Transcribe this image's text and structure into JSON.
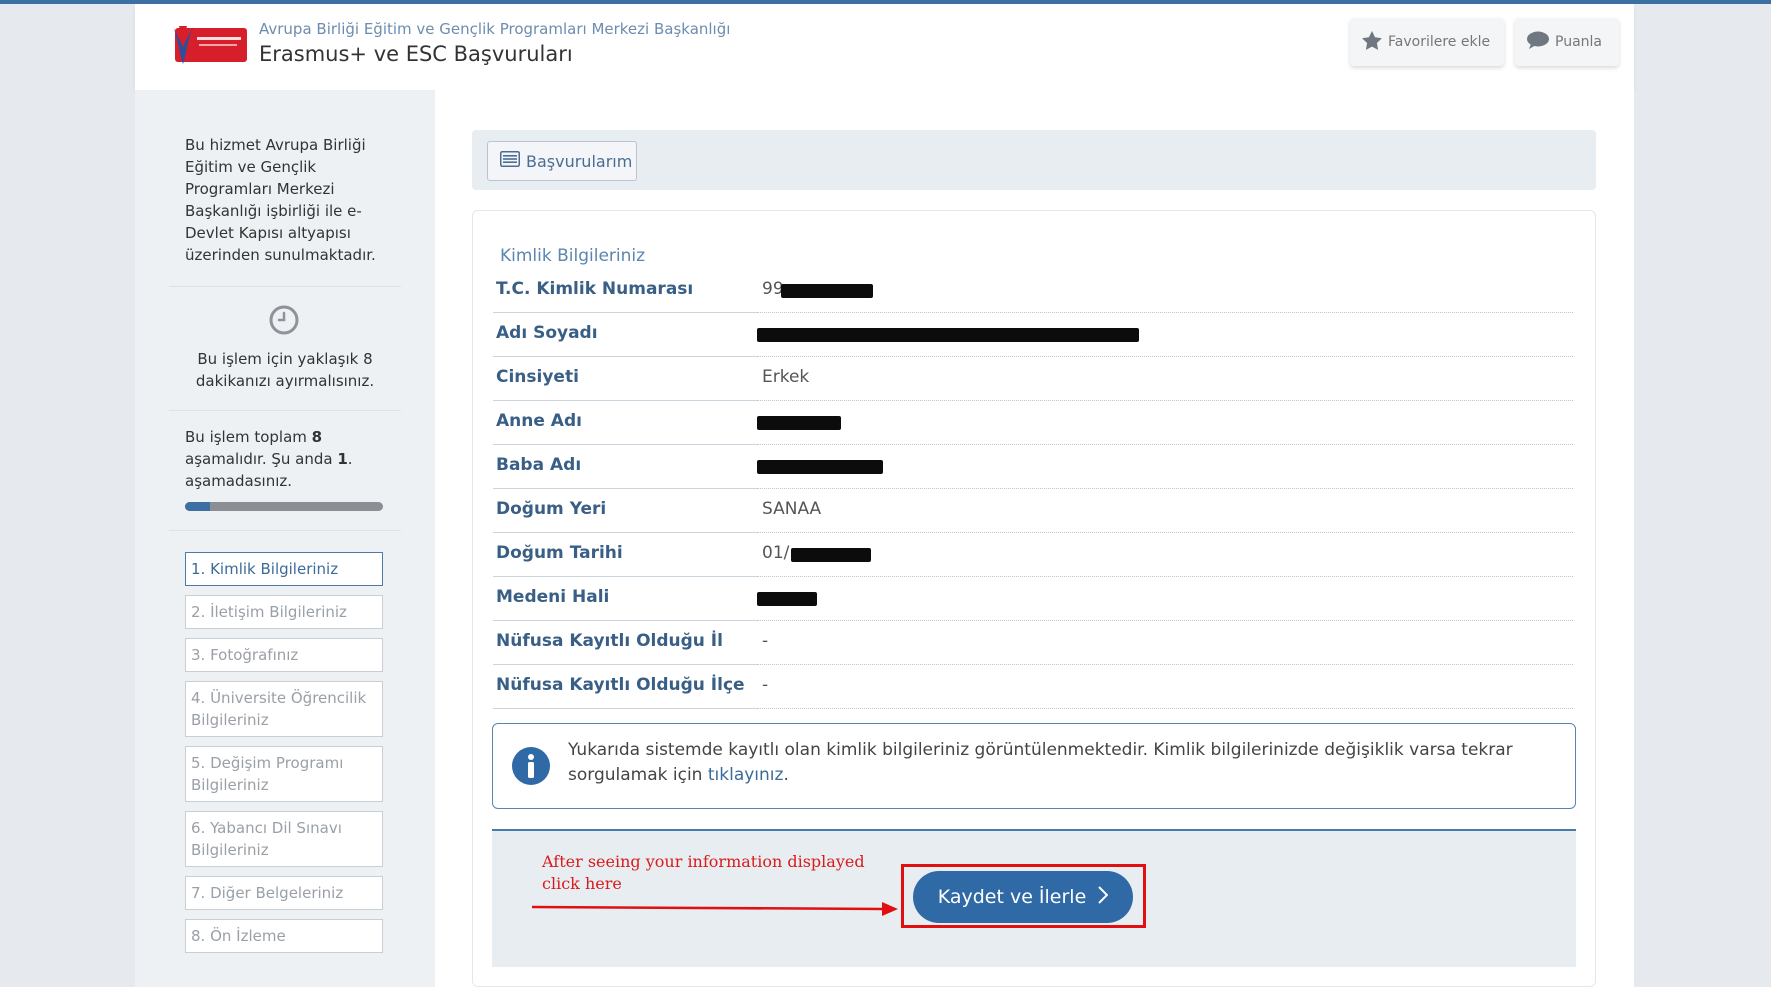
{
  "header": {
    "org_name": "Avrupa Birliği Eğitim ve Gençlik Programları Merkezi Başkanlığı",
    "title": "Erasmus+ ve ESC Başvuruları",
    "favorite_label": "Favorilere ekle",
    "rate_label": "Puanla"
  },
  "sidebar": {
    "intro": "Bu hizmet Avrupa Birliği Eğitim ve Gençlik Programları Merkezi Başkanlığı işbirliği ile e-Devlet Kapısı altyapısı üzerinden sunulmaktadır.",
    "time_text": "Bu işlem için yaklaşık 8 dakikanızı ayırmalısınız.",
    "steps_text_1": "Bu işlem toplam ",
    "steps_total": "8",
    "steps_text_2": " aşamalıdır. Şu anda ",
    "steps_current": "1",
    "steps_text_3": ". aşamadasınız.",
    "progress_fraction": 0.125,
    "steps": [
      "1. Kimlik Bilgileriniz",
      "2. İletişim Bilgileriniz",
      "3. Fotoğrafınız",
      "4. Üniversite Öğrencilik Bilgileriniz",
      "5. Değişim Programı Bilgileriniz",
      "6. Yabancı Dil Sınavı Bilgileriniz",
      "7. Diğer Belgeleriniz",
      "8. Ön İzleme"
    ]
  },
  "toolbar": {
    "applications_label": "Başvurularım"
  },
  "identity": {
    "section_title": "Kimlik Bilgileriniz",
    "rows": [
      {
        "label": "T.C. Kimlik Numarası",
        "value": "99"
      },
      {
        "label": "Adı Soyadı",
        "value": ""
      },
      {
        "label": "Cinsiyeti",
        "value": "Erkek"
      },
      {
        "label": "Anne Adı",
        "value": ""
      },
      {
        "label": "Baba Adı",
        "value": ""
      },
      {
        "label": "Doğum Yeri",
        "value": "SANAA"
      },
      {
        "label": "Doğum Tarihi",
        "value": "01/"
      },
      {
        "label": "Medeni Hali",
        "value": ""
      },
      {
        "label": "Nüfusa Kayıtlı Olduğu İl",
        "value": "-"
      },
      {
        "label": "Nüfusa Kayıtlı Olduğu İlçe",
        "value": "-"
      }
    ]
  },
  "info": {
    "text": "Yukarıda sistemde kayıtlı olan kimlik bilgileriniz görüntülenmektedir. Kimlik bilgilerinizde değişiklik varsa tekrar sorgulamak için ",
    "link": "tıklayınız",
    "end": "."
  },
  "footer": {
    "annotation": "After seeing your information displayed\nclick here",
    "save_label": "Kaydet ve İlerle"
  },
  "colors": {
    "accent": "#2f69a6",
    "label_blue": "#3a5f86",
    "annotation_red": "#d81b1b"
  },
  "icons": [
    "star-icon",
    "chat-icon",
    "clock-icon",
    "list-icon",
    "info-icon",
    "chevron-right-icon"
  ]
}
